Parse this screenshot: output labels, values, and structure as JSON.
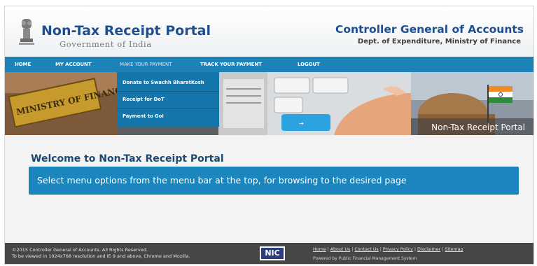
{
  "header": {
    "site_title": "Non-Tax Receipt Portal",
    "site_subtitle": "Government of India",
    "org_name": "Controller General of Accounts",
    "org_subtitle": "Dept. of Expenditure, Ministry of Finance"
  },
  "nav": {
    "items": [
      {
        "label": "HOME"
      },
      {
        "label": "MY ACCOUNT"
      },
      {
        "label": "MAKE YOUR PAYMENT"
      },
      {
        "label": "TRACK YOUR PAYMENT"
      },
      {
        "label": "LOGOUT"
      }
    ]
  },
  "dropdown": {
    "items": [
      {
        "label": "Donate to Swachh BharatKosh"
      },
      {
        "label": "Receipt for DoT"
      },
      {
        "label": "Payment to GoI"
      }
    ]
  },
  "banner": {
    "sign_text": "MINISTRY OF FINANCE",
    "caption": "Non-Tax Receipt Portal"
  },
  "main": {
    "welcome_title": "Welcome to Non-Tax Receipt Portal",
    "info_text": "Select menu options from the menu bar at the top, for browsing to the desired page"
  },
  "footer": {
    "copyright": "©2015 Controller General of Accounts. All Rights Reserved.",
    "resolution_note": "To be viewed in 1024x768 resolution and IE 9 and above, Chrome and Mozilla.",
    "nic_logo": "NIC",
    "links": [
      {
        "label": "Home"
      },
      {
        "label": "About Us"
      },
      {
        "label": "Contact Us"
      },
      {
        "label": "Privacy Policy"
      },
      {
        "label": "Disclaimer"
      },
      {
        "label": "Sitemap"
      }
    ],
    "powered_by": "Powered by Public Financial Management System"
  },
  "colors": {
    "nav_bg": "#1d82b7",
    "dropdown_bg": "#1476ab",
    "info_box_bg": "#1a86bd",
    "title_blue": "#1f4e8f",
    "footer_bg": "#464646"
  }
}
